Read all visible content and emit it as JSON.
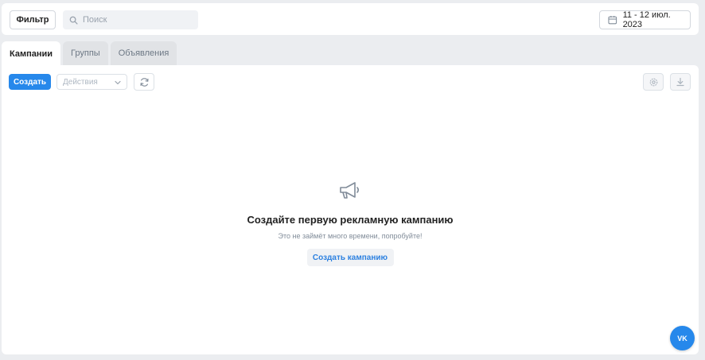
{
  "topbar": {
    "filter_label": "Фильтр",
    "search_placeholder": "Поиск",
    "date_range": "11 - 12 июл. 2023"
  },
  "tabs": [
    {
      "label": "Кампании",
      "active": true
    },
    {
      "label": "Группы",
      "active": false
    },
    {
      "label": "Объявления",
      "active": false
    }
  ],
  "toolbar": {
    "create_label": "Создать",
    "actions_placeholder": "Действия"
  },
  "empty_state": {
    "icon": "megaphone-icon",
    "title": "Создайте первую рекламную кампанию",
    "subtitle": "Это не займёт много времени, попробуйте!",
    "button_label": "Создать кампанию"
  },
  "fab": {
    "label": "VK",
    "icon": "vk-logo-icon"
  },
  "colors": {
    "accent": "#2688eb",
    "background": "#ebedf0",
    "link": "#2d81e0"
  }
}
